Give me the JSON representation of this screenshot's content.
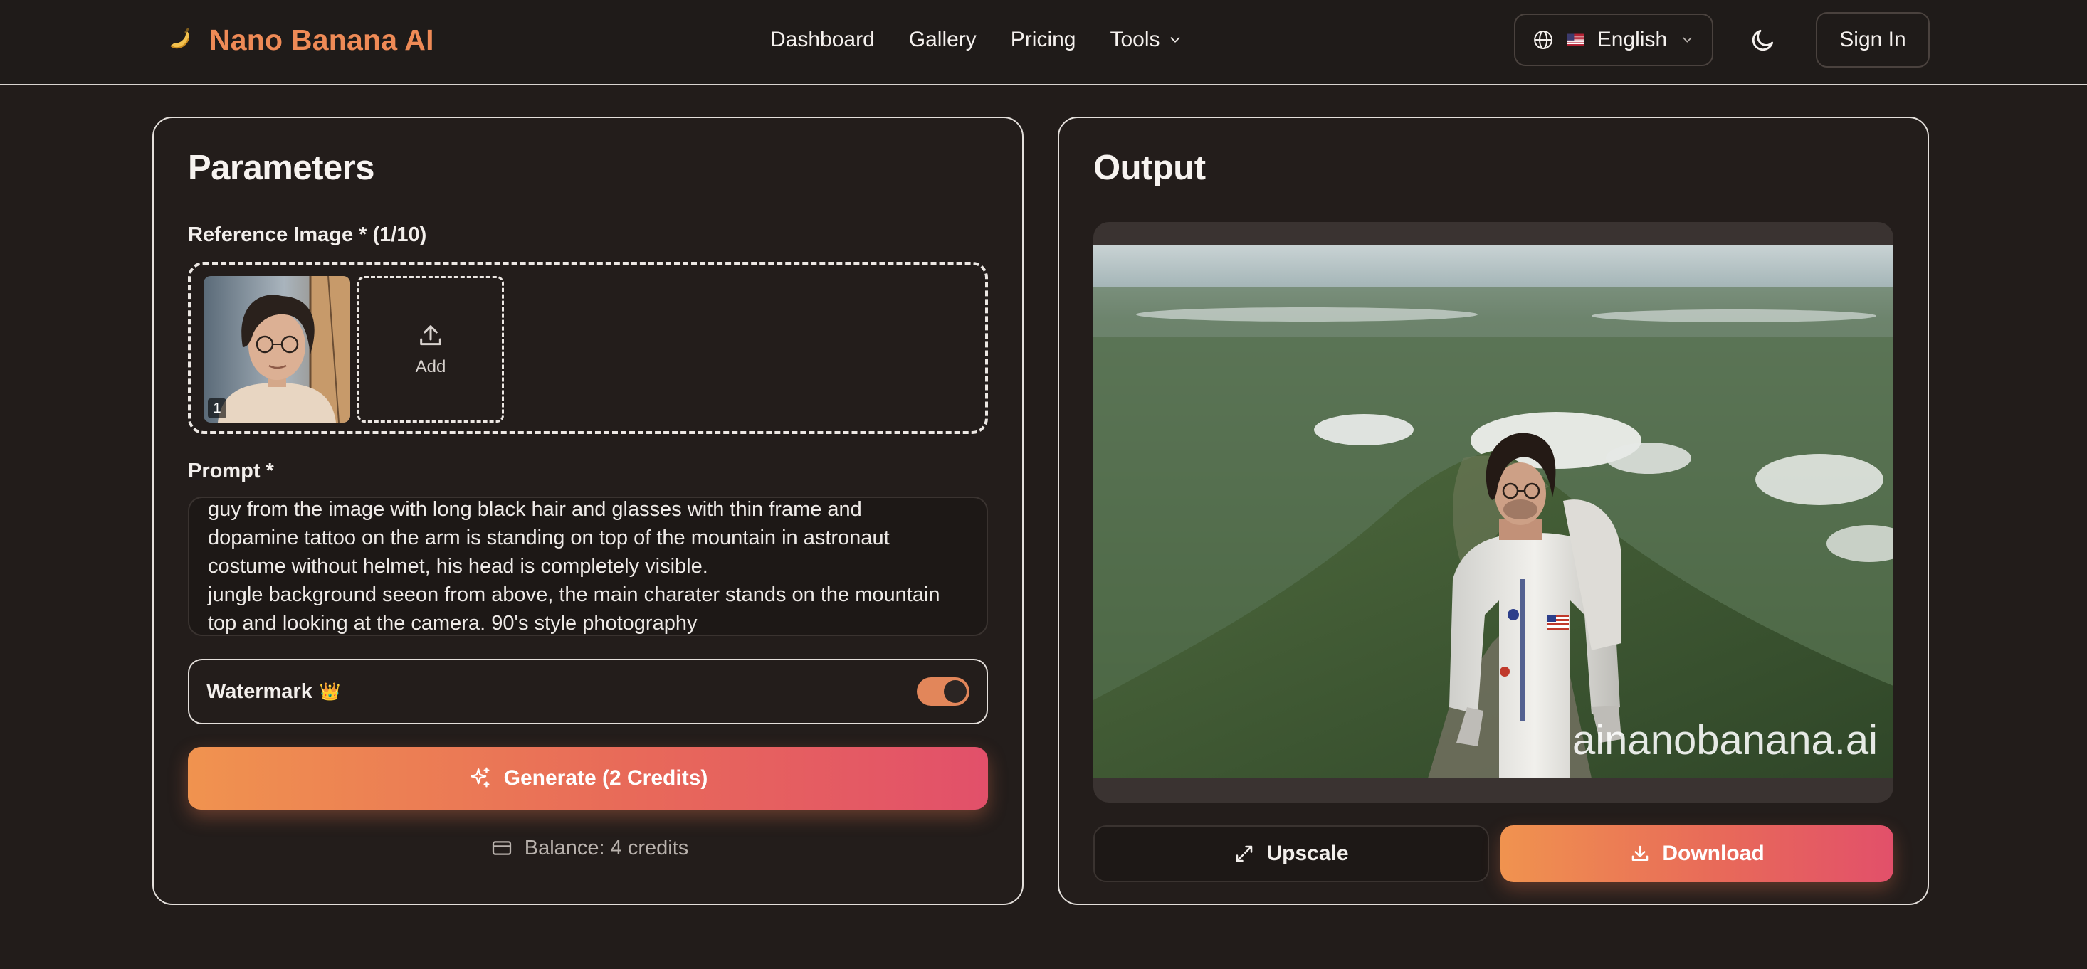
{
  "brand": {
    "name": "Nano Banana AI",
    "logo_icon": "banana-icon",
    "accent_color": "#ee8a56"
  },
  "nav": {
    "items": [
      {
        "label": "Dashboard"
      },
      {
        "label": "Gallery"
      },
      {
        "label": "Pricing"
      },
      {
        "label": "Tools",
        "has_dropdown": true
      }
    ]
  },
  "header": {
    "language": {
      "label": "English",
      "icon": "globe-icon",
      "flag": "us-flag"
    },
    "theme_toggle_icon": "moon-icon",
    "sign_in_label": "Sign In"
  },
  "parameters": {
    "title": "Parameters",
    "reference_label": "Reference Image * (1/10)",
    "thumb_index": "1",
    "add_label": "Add",
    "prompt_label": "Prompt *",
    "prompt_value": "guy from the image with long black hair and glasses with thin frame and\ndopamine tattoo on the arm is standing on top of the mountain in astronaut\ncostume without helmet, his head is completely visible.\njungle background seeon from above, the main charater stands on the mountain\ntop and looking at the camera. 90's style photography",
    "watermark_label": "Watermark",
    "watermark_enabled": true,
    "generate_label": "Generate (2 Credits)",
    "balance_label": "Balance: 4 credits"
  },
  "output": {
    "title": "Output",
    "watermark_text": "ainanobanana.ai",
    "upscale_label": "Upscale",
    "download_label": "Download"
  },
  "colors": {
    "background": "#221c1a",
    "gradient_start": "#f0934f",
    "gradient_end": "#e2506a",
    "toggle_on": "#e2865a"
  }
}
